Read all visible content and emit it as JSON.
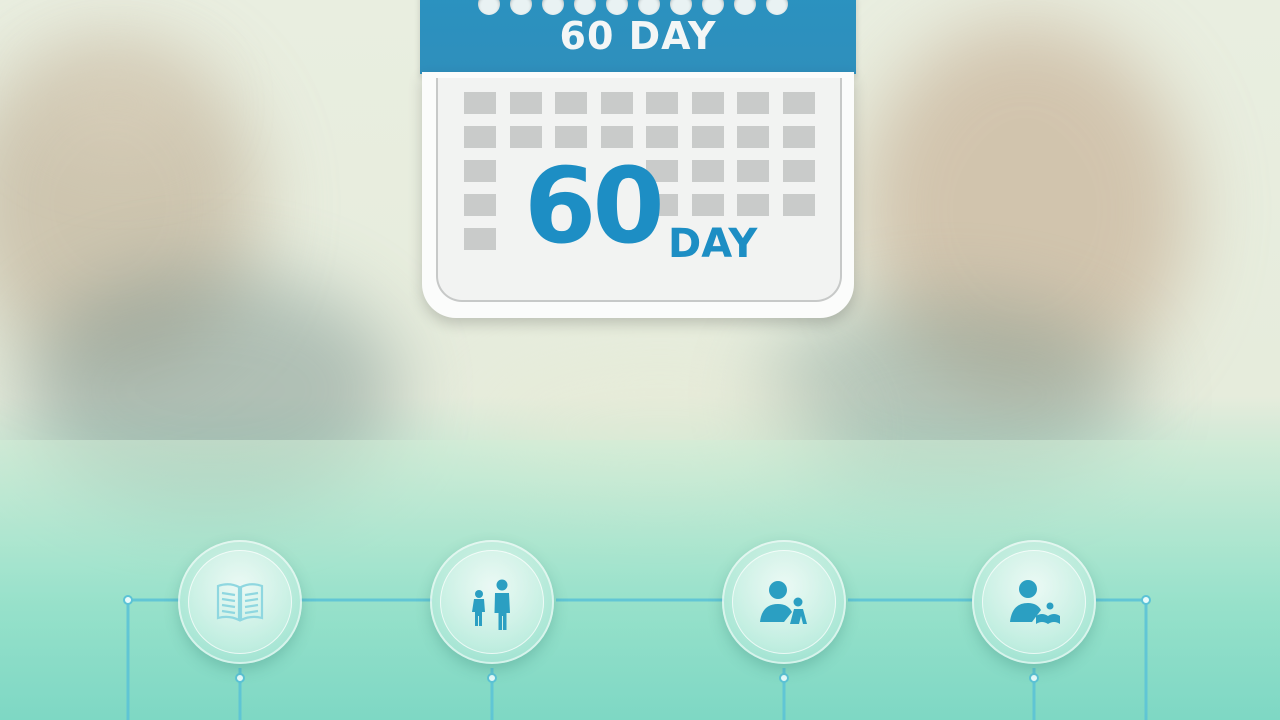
{
  "calendar": {
    "header_label": "60 DAY",
    "number": "60",
    "unit": "DAY",
    "accent_color": "#1d8ec4"
  },
  "timeline": {
    "line_color": "#5cc3d6",
    "steps": [
      {
        "icon": "open-book-icon"
      },
      {
        "icon": "adult-child-icon"
      },
      {
        "icon": "person-with-child-icon"
      },
      {
        "icon": "person-reading-icon"
      }
    ]
  }
}
